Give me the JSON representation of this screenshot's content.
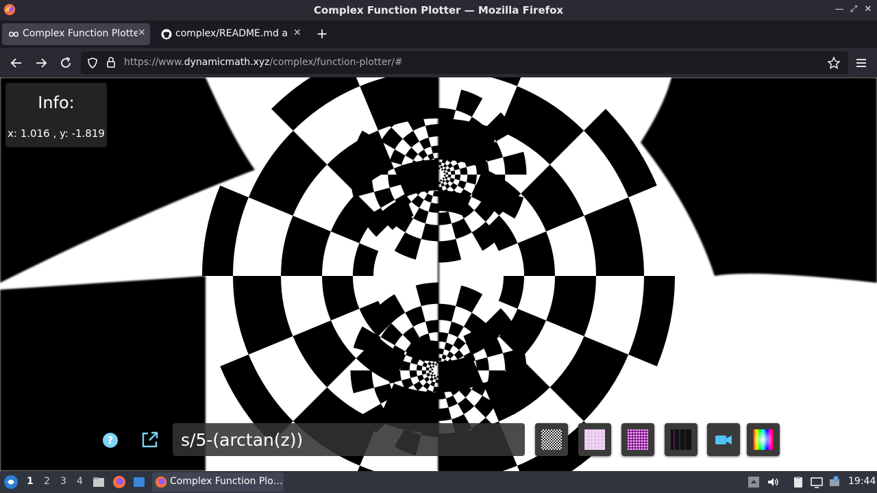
{
  "window": {
    "title": "Complex Function Plotter — Mozilla Firefox"
  },
  "tabs": [
    {
      "label": "Complex Function Plotter",
      "icon": "infinity-icon",
      "active": true
    },
    {
      "label": "complex/README.md at",
      "icon": "github-icon",
      "active": false
    }
  ],
  "url": {
    "prefix": "https://www.",
    "host": "dynamicmath.xyz",
    "path": "/complex/function-plotter/#"
  },
  "info": {
    "heading": "Info:",
    "coords": "x: 1.016 , y: -1.819"
  },
  "formula": {
    "value": "s/5-(arctan(z))"
  },
  "toolbar_icons": [
    "help-icon",
    "share-icon",
    "checkerboard-texture",
    "grid-texture",
    "pink-texture",
    "dark-texture",
    "camera-icon",
    "color-wheel-icon"
  ],
  "taskbar": {
    "workspaces": [
      "1",
      "2",
      "3",
      "4"
    ],
    "active_task": "Complex Function Plo…",
    "clock": "19:44"
  },
  "colors": {
    "titlebar": "#2b2a33",
    "tab_active": "#42414d",
    "accent": "#4fc3f7",
    "taskbar": "#2f343f"
  }
}
